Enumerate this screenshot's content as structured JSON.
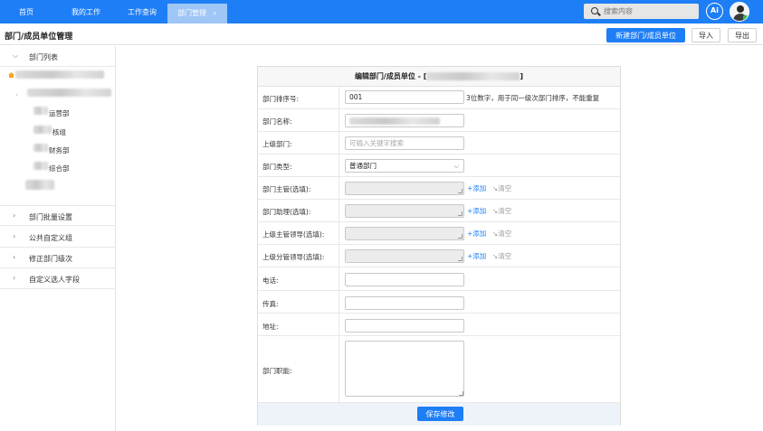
{
  "nav": {
    "tabs": [
      {
        "label": "首页"
      },
      {
        "label": "我的工作"
      },
      {
        "label": "工作查询"
      },
      {
        "label": "部门管理",
        "close": "×"
      }
    ],
    "search_placeholder": "搜索内容",
    "ai_label": "Ai"
  },
  "header": {
    "title": "部门/成员单位管理",
    "new_button": "新建部门/成员单位",
    "import_button": "导入",
    "export_button": "导出"
  },
  "sidebar": {
    "dept_list": "部门列表",
    "tree": [
      {
        "label": "运营部"
      },
      {
        "label": "核组"
      },
      {
        "label": "财务部"
      },
      {
        "label": "综合部"
      }
    ],
    "sections": [
      {
        "label": "部门批量设置"
      },
      {
        "label": "公共自定义组"
      },
      {
        "label": "修正部门级次"
      },
      {
        "label": "自定义选人字段"
      }
    ]
  },
  "form": {
    "title": "编辑部门/成员单位 - [",
    "title_end": "]",
    "sort_label": "部门排序号:",
    "sort_value": "001",
    "sort_hint": "3位数字，用于同一级次部门排序，不能重复",
    "name_label": "部门名称:",
    "parent_label": "上级部门:",
    "parent_placeholder": "可输入关键字搜索",
    "type_label": "部门类型:",
    "type_value": "普通部门",
    "manager_label": "部门主管(选填):",
    "assistant_label": "部门助理(选填):",
    "sup_manager_label": "上级主管领导(选填):",
    "sup_branch_label": "上级分管领导(选填):",
    "add_label": "+添加",
    "clear_label": "清空",
    "phone_label": "电话:",
    "fax_label": "传真:",
    "address_label": "地址:",
    "duty_label": "部门职能:",
    "save_button": "保存修改"
  }
}
